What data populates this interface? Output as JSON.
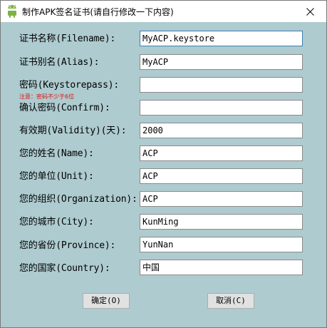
{
  "window": {
    "title": "制作APK签名证书(请自行修改一下内容)",
    "app_icon": "android-icon",
    "close_icon": "close-icon"
  },
  "form": {
    "hint": "注意：密码不少于6位",
    "fields": [
      {
        "label": "证书名称(Filename):",
        "value": "MyACP.keystore"
      },
      {
        "label": "证书别名(Alias):",
        "value": "MyACP"
      },
      {
        "label": "密码(Keystorepass):",
        "value": ""
      },
      {
        "label": "确认密码(Confirm):",
        "value": ""
      },
      {
        "label": "有效期(Validity)(天):",
        "value": "2000"
      },
      {
        "label": "您的姓名(Name):",
        "value": "ACP"
      },
      {
        "label": "您的单位(Unit):",
        "value": "ACP"
      },
      {
        "label": "您的组织(Organization):",
        "value": "ACP"
      },
      {
        "label": "您的城市(City):",
        "value": "KunMing"
      },
      {
        "label": "您的省份(Province):",
        "value": "YunNan"
      },
      {
        "label": "您的国家(Country):",
        "value": "中国"
      }
    ]
  },
  "buttons": {
    "ok_label": "确定(O)",
    "cancel_label": "取消(C)"
  }
}
